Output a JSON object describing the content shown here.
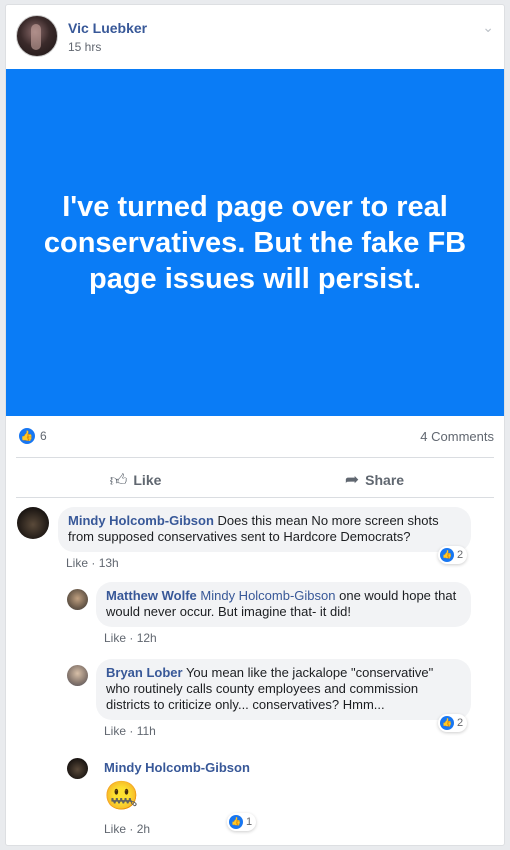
{
  "post": {
    "author": "Vic Luebker",
    "time": "15 hrs",
    "text": "I've turned page over to real conservatives. But the fake FB page issues will persist.",
    "banner_color": "#0a7cf6",
    "reaction_count": "6",
    "comments_count": "4 Comments",
    "like_label": "Like",
    "share_label": "Share"
  },
  "comments": [
    {
      "name": "Mindy Holcomb-Gibson",
      "text": " Does this mean No more screen shots from supposed conservatives sent to Hardcore Democrats?",
      "like": "Like",
      "time": "13h",
      "reactions": "2"
    },
    {
      "name": "Matthew Wolfe",
      "mention": "Mindy Holcomb-Gibson",
      "text": " one would hope that would never occur. But imagine that- it did!",
      "like": "Like",
      "time": "12h"
    },
    {
      "name": "Bryan Lober",
      "text": " You mean like the jackalope \"conservative\" who routinely calls county employees and commission districts to criticize only... conservatives? Hmm...",
      "like": "Like",
      "time": "11h",
      "reactions": "2"
    },
    {
      "name": "Mindy Holcomb-Gibson",
      "emoji": "🤐",
      "like": "Like",
      "time": "2h",
      "reactions": "1"
    }
  ],
  "meta_sep": " · ",
  "icons": {
    "chevron": "chevron-down-icon",
    "like_badge": "thumbs-up-icon",
    "like_action": "like-icon",
    "share_action": "share-icon"
  },
  "colors": {
    "link": "#385898",
    "like_blue": "#1877f2"
  }
}
